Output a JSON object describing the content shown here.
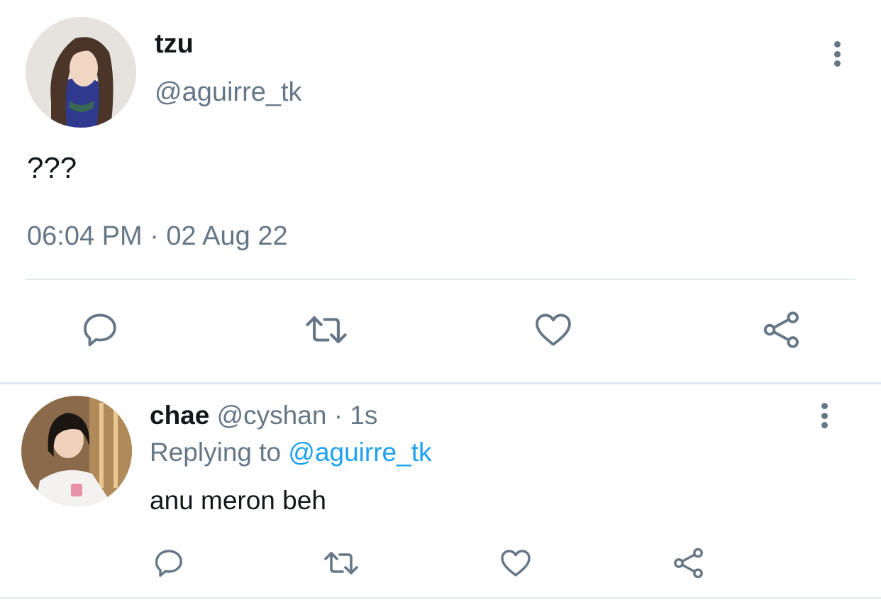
{
  "main_tweet": {
    "display_name": "tzu",
    "handle": "@aguirre_tk",
    "text": "???",
    "timestamp": "06:04 PM · 02 Aug 22",
    "avatar_icon": "avatar-photo",
    "actions": [
      "reply-icon",
      "retweet-icon",
      "like-icon",
      "share-icon"
    ]
  },
  "reply_tweet": {
    "display_name": "chae",
    "handle": "@cyshan",
    "age": "· 1s",
    "replying_prefix": "Replying to",
    "replying_handle": "@aguirre_tk",
    "text": "anu meron beh",
    "avatar_icon": "avatar-photo",
    "actions": [
      "reply-icon",
      "retweet-icon",
      "like-icon",
      "share-icon"
    ]
  },
  "colors": {
    "text": "#14171a",
    "secondary": "#657786",
    "link": "#1da1f2",
    "divider": "#e1e8ed"
  }
}
